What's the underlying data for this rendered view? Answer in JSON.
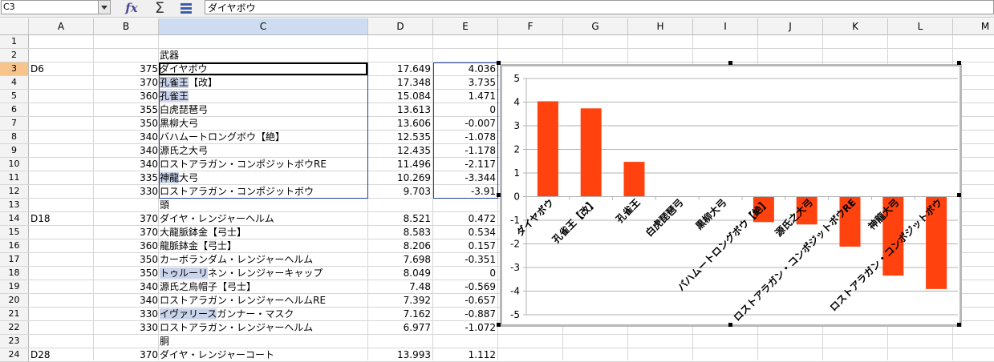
{
  "namebox": {
    "value": "C3"
  },
  "formula_bar": {
    "value": "ダイヤボウ"
  },
  "columns": [
    "A",
    "B",
    "C",
    "D",
    "E",
    "F",
    "G",
    "H",
    "I",
    "J",
    "K",
    "L",
    "M"
  ],
  "rows": [
    {
      "n": "1",
      "a": "",
      "b": "",
      "c": "",
      "d": "",
      "e": ""
    },
    {
      "n": "2",
      "a": "",
      "b": "",
      "c": "武器",
      "d": "",
      "e": ""
    },
    {
      "n": "3",
      "a": "D6",
      "b": "375",
      "c": "ダイヤボウ",
      "d": "17.649",
      "e": "4.036"
    },
    {
      "n": "4",
      "a": "",
      "b": "370",
      "c": "孔雀王【改】",
      "d": "17.348",
      "e": "3.735"
    },
    {
      "n": "5",
      "a": "",
      "b": "360",
      "c": "孔雀王",
      "d": "15.084",
      "e": "1.471"
    },
    {
      "n": "6",
      "a": "",
      "b": "355",
      "c": "白虎琵琶弓",
      "d": "13.613",
      "e": "0"
    },
    {
      "n": "7",
      "a": "",
      "b": "350",
      "c": "黒柳大弓",
      "d": "13.606",
      "e": "-0.007"
    },
    {
      "n": "8",
      "a": "",
      "b": "340",
      "c": "バハムートロングボウ【絶】",
      "d": "12.535",
      "e": "-1.078"
    },
    {
      "n": "9",
      "a": "",
      "b": "340",
      "c": "源氏之大弓",
      "d": "12.435",
      "e": "-1.178"
    },
    {
      "n": "10",
      "a": "",
      "b": "340",
      "c": "ロストアラガン・コンポジットボウRE",
      "d": "11.496",
      "e": "-2.117"
    },
    {
      "n": "11",
      "a": "",
      "b": "335",
      "c": "神龍大弓",
      "d": "10.269",
      "e": "-3.344"
    },
    {
      "n": "12",
      "a": "",
      "b": "330",
      "c": "ロストアラガン・コンポジットボウ",
      "d": "9.703",
      "e": "-3.91"
    },
    {
      "n": "13",
      "a": "",
      "b": "",
      "c": "頭",
      "d": "",
      "e": ""
    },
    {
      "n": "14",
      "a": "D18",
      "b": "370",
      "c": "ダイヤ・レンジャーヘルム",
      "d": "8.521",
      "e": "0.472"
    },
    {
      "n": "15",
      "a": "",
      "b": "370",
      "c": "大龍脈鉢金【弓士】",
      "d": "8.583",
      "e": "0.534"
    },
    {
      "n": "16",
      "a": "",
      "b": "360",
      "c": "龍脈鉢金【弓士】",
      "d": "8.206",
      "e": "0.157"
    },
    {
      "n": "17",
      "a": "",
      "b": "350",
      "c": "カーボランダム・レンジャーヘルム",
      "d": "7.698",
      "e": "-0.351"
    },
    {
      "n": "18",
      "a": "",
      "b": "350",
      "c": "トゥルーリネン・レンジャーキャップ",
      "d": "8.049",
      "e": "0"
    },
    {
      "n": "19",
      "a": "",
      "b": "340",
      "c": "源氏之烏帽子【弓士】",
      "d": "7.48",
      "e": "-0.569"
    },
    {
      "n": "20",
      "a": "",
      "b": "340",
      "c": "ロストアラガン・レンジャーヘルムRE",
      "d": "7.392",
      "e": "-0.657"
    },
    {
      "n": "21",
      "a": "",
      "b": "330",
      "c": "イヴァリースガンナー・マスク",
      "d": "7.162",
      "e": "-0.887"
    },
    {
      "n": "22",
      "a": "",
      "b": "330",
      "c": "ロストアラガン・レンジャーヘルム",
      "d": "6.977",
      "e": "-1.072"
    },
    {
      "n": "23",
      "a": "",
      "b": "",
      "c": "胴",
      "d": "",
      "e": ""
    },
    {
      "n": "24",
      "a": "D28",
      "b": "370",
      "c": "ダイヤ・レンジャーコート",
      "d": "13.993",
      "e": "1.112"
    }
  ],
  "highlights": {
    "4": "孔雀王",
    "5": "孔雀王",
    "11": "神龍",
    "18": "トゥルーリ",
    "21": "イヴァリース"
  },
  "chart_data": {
    "type": "bar",
    "categories": [
      "ダイヤボウ",
      "孔雀王【改】",
      "孔雀王",
      "白虎琵琶弓",
      "黒柳大弓",
      "バハムートロングボウ【絶】",
      "源氏之大弓",
      "ロストアラガン・コンポジットボウRE",
      "神龍大弓",
      "ロストアラガン・コンポジットボウ"
    ],
    "values": [
      4.036,
      3.735,
      1.471,
      0,
      -0.007,
      -1.078,
      -1.178,
      -2.117,
      -3.344,
      -3.91
    ],
    "ylim": [
      -5,
      5
    ],
    "yticks": [
      "5",
      "4",
      "3",
      "2",
      "1",
      "0",
      "-1",
      "-2",
      "-3",
      "-4",
      "-5"
    ],
    "grid": true,
    "color": "#ff420e"
  }
}
